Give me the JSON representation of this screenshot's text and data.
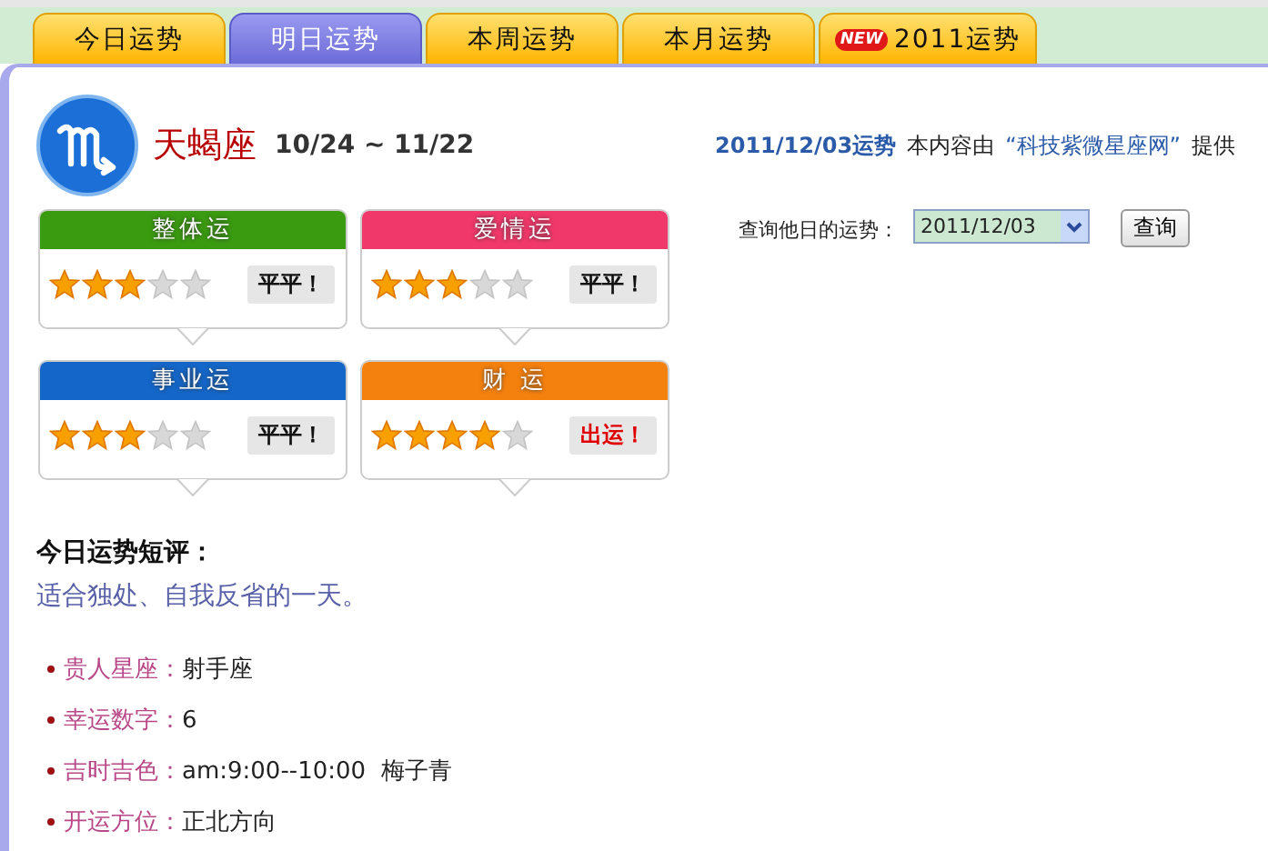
{
  "tabs": [
    {
      "label": "今日运势",
      "selected": false
    },
    {
      "label": "明日运势",
      "selected": true
    },
    {
      "label": "本周运势",
      "selected": false
    },
    {
      "label": "本月运势",
      "selected": false
    },
    {
      "label": "2011运势",
      "selected": false,
      "badge": "NEW"
    }
  ],
  "sign": {
    "name": "天蝎座",
    "dates": "10/24 ~ 11/22"
  },
  "source": {
    "date_link": "2011/12/03运势",
    "prefix": "本内容由",
    "provider_link": "“科技紫微星座网”",
    "suffix": "提供"
  },
  "fortunes": [
    {
      "title": "整体运",
      "color": "#3a9a10",
      "stars": 3,
      "verdict": "平平！",
      "highlight": false
    },
    {
      "title": "爱情运",
      "color": "#f0386a",
      "stars": 3,
      "verdict": "平平！",
      "highlight": false
    },
    {
      "title": "事业运",
      "color": "#1466c8",
      "stars": 3,
      "verdict": "平平！",
      "highlight": false
    },
    {
      "title": "财 运",
      "color": "#f4800e",
      "stars": 4,
      "verdict": "出运！",
      "highlight": true
    }
  ],
  "query": {
    "label": "查询他日的运势：",
    "value": "2011/12/03",
    "button": "查询"
  },
  "summary": {
    "heading": "今日运势短评：",
    "text": "适合独处、自我反省的一天。"
  },
  "details": [
    {
      "label": "贵人星座：",
      "value": "射手座"
    },
    {
      "label": "幸运数字：",
      "value": "6"
    },
    {
      "label": "吉时吉色：",
      "value": "am:9:00--10:00  梅子青"
    },
    {
      "label": "开运方位：",
      "value": "正北方向"
    }
  ]
}
